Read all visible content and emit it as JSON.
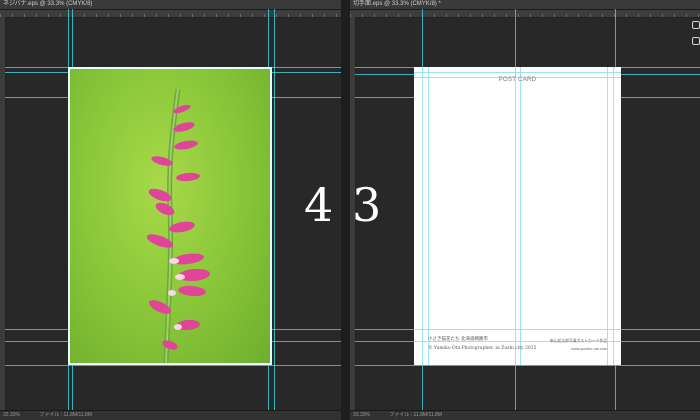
{
  "left_document": {
    "tab_title": "ネジバナ.eps @ 33.3% (CMYK/8)",
    "status_zoom": "33.33%",
    "status_info": "ファイル : 11.8M/11.8M"
  },
  "right_document": {
    "tab_title": "切手面.eps @ 33.3% (CMYK/8) *",
    "status_zoom": "33.33%",
    "status_info": "ファイル : 11.8M/11.8M",
    "postcard": {
      "title": "POST CARD",
      "caption": "小さき猫花たち  北海道網路市",
      "copyright": "© Yumiko Ota Photographer, in Zushi city 2015",
      "credit_line": "新山花太郎写真ポストカード作品",
      "website": "www.yumiko-ota.com"
    }
  },
  "overlay": {
    "left_number": "4",
    "right_number": "3"
  },
  "colors": {
    "guide": "#3ec9d6",
    "canvas": "#282828",
    "photo_green": "#8cc93a",
    "flower_pink": "#e0459a"
  },
  "icons": [
    "panel-toggle-icon",
    "panel-layers-icon"
  ]
}
